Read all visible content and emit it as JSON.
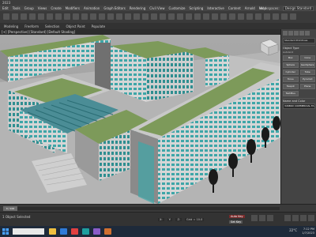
{
  "window": {
    "title": "2023"
  },
  "menu": {
    "items": [
      "Edit",
      "Tools",
      "Group",
      "Views",
      "Create",
      "Modifiers",
      "Animation",
      "Graph Editors",
      "Rendering",
      "Civil View",
      "Customize",
      "Scripting",
      "Interactive",
      "Content",
      "Arnold",
      "Help"
    ],
    "workspace_label": "Workspaces:",
    "workspace_value": "Design Standard"
  },
  "ribbon": {
    "tabs": [
      "Modeling",
      "Freeform",
      "Selection",
      "Object Paint",
      "Populate"
    ]
  },
  "viewport": {
    "label": "[+] [Perspective] [Standard] [Default Shading]"
  },
  "command_panel": {
    "dropdown": "Standard Primitives",
    "object_type_title": "Object Type",
    "autogrid": "AutoGrid",
    "buttons": [
      "Box",
      "Cone",
      "Sphere",
      "GeoSphere",
      "Cylinder",
      "Tube",
      "Torus",
      "Pyramid",
      "Teapot",
      "Plane",
      "TextPlus"
    ],
    "name_color_title": "Name and Color",
    "object_name": "3d6BOX COMMERCIAL FA"
  },
  "timeslider": {
    "position": "0 / 100"
  },
  "status": {
    "selection": "1 Object Selected",
    "x_label": "X:",
    "y_label": "Y:",
    "z_label": "Z:",
    "grid": "Grid = 10.0",
    "auto_key": "Auto Key",
    "set_key": "Set Key"
  },
  "taskbar": {
    "weather": "22°C",
    "time": "7:12 PM",
    "date": "1/7/2023"
  },
  "colors": {
    "building_wall": "#c8c8c8",
    "roof_green": "#7d9a5a",
    "glass": "#3ea6a8",
    "accent": "#1b6fc4"
  }
}
